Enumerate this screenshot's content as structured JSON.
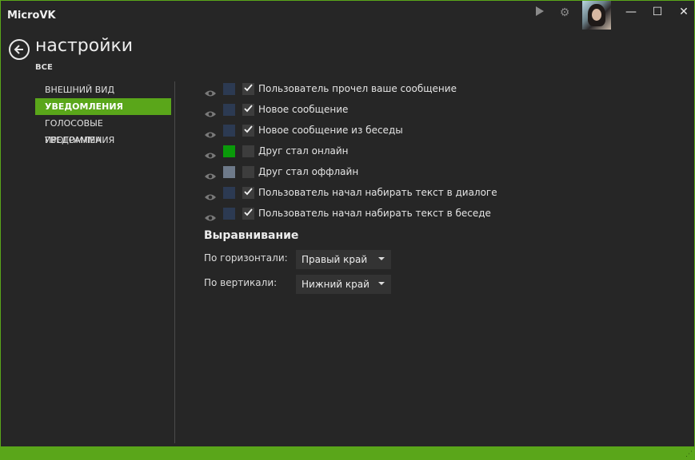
{
  "app": {
    "title": "MicroVK"
  },
  "toolbar": {
    "play_icon": "play-icon",
    "settings_icon": "gear-icon"
  },
  "window_controls": {
    "minimize": "—",
    "maximize": "☐",
    "close": "✕"
  },
  "header": {
    "title": "настройки",
    "breadcrumb": "ВСЕ"
  },
  "nav": {
    "items": [
      {
        "label": "ВНЕШНИЙ ВИД",
        "active": false
      },
      {
        "label": "УВЕДОМЛЕНИЯ",
        "active": true
      },
      {
        "label": "ГОЛОСОВЫЕ УВЕДОМЛЕНИЯ",
        "active": false
      },
      {
        "label": "ПРОГРАММА",
        "active": false
      }
    ]
  },
  "notifications": [
    {
      "label": "Пользователь прочел ваше сообщение",
      "color": "#2c3a52",
      "checked": true
    },
    {
      "label": "Новое сообщение",
      "color": "#2c3a52",
      "checked": true
    },
    {
      "label": "Новое сообщение из беседы",
      "color": "#2c3a52",
      "checked": true
    },
    {
      "label": "Друг стал онлайн",
      "color": "#0a9a0a",
      "checked": false
    },
    {
      "label": "Друг стал оффлайн",
      "color": "#6e7a8a",
      "checked": false
    },
    {
      "label": "Пользователь начал набирать текст в диалоге",
      "color": "#2c3a52",
      "checked": true
    },
    {
      "label": "Пользователь начал набирать текст в беседе",
      "color": "#2c3a52",
      "checked": true
    }
  ],
  "alignment": {
    "title": "Выравнивание",
    "horizontal_label": "По горизонтали:",
    "horizontal_value": "Правый край",
    "vertical_label": "По вертикали:",
    "vertical_value": "Нижний край"
  },
  "colors": {
    "accent": "#5aa61a",
    "background": "#262626"
  }
}
